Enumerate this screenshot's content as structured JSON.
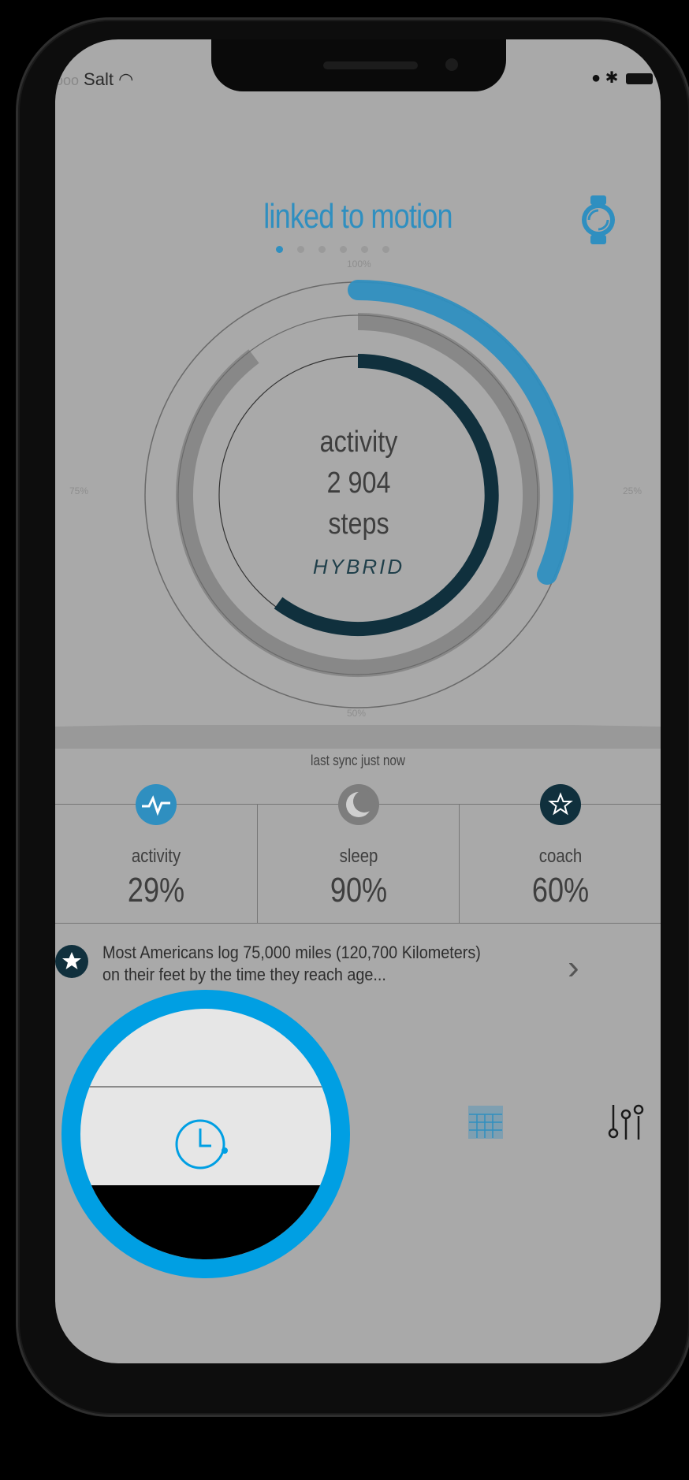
{
  "status_bar": {
    "carrier": "Salt",
    "signal_dots": "ooo"
  },
  "header": {
    "title": "linked to motion",
    "page_count": 6,
    "active_page": 0
  },
  "ring": {
    "top_label": "100%",
    "left_label": "75%",
    "right_label": "25%",
    "bottom_label": "50%",
    "center_line1": "activity",
    "center_line2": "2 904",
    "center_line3": "steps",
    "brand": "HYBRID",
    "outer_progress": 0.29,
    "middle_progress": 0.9,
    "inner_progress": 0.6
  },
  "sync_text": "last sync just now",
  "stats": [
    {
      "name": "activity",
      "value": "29%"
    },
    {
      "name": "sleep",
      "value": "90%"
    },
    {
      "name": "coach",
      "value": "60%"
    }
  ],
  "tip": {
    "text": "Most Americans log 75,000 miles (120,700 Kilometers) on their feet by the time they reach age..."
  },
  "colors": {
    "accent": "#2f8fc0",
    "highlight": "#009fe3",
    "dark": "#10303d",
    "screen_bg": "#a9a9a9"
  },
  "tabbar": {
    "icons": [
      "clock-icon",
      "list-icon",
      "calendar-icon",
      "settings-sliders-icon"
    ]
  }
}
